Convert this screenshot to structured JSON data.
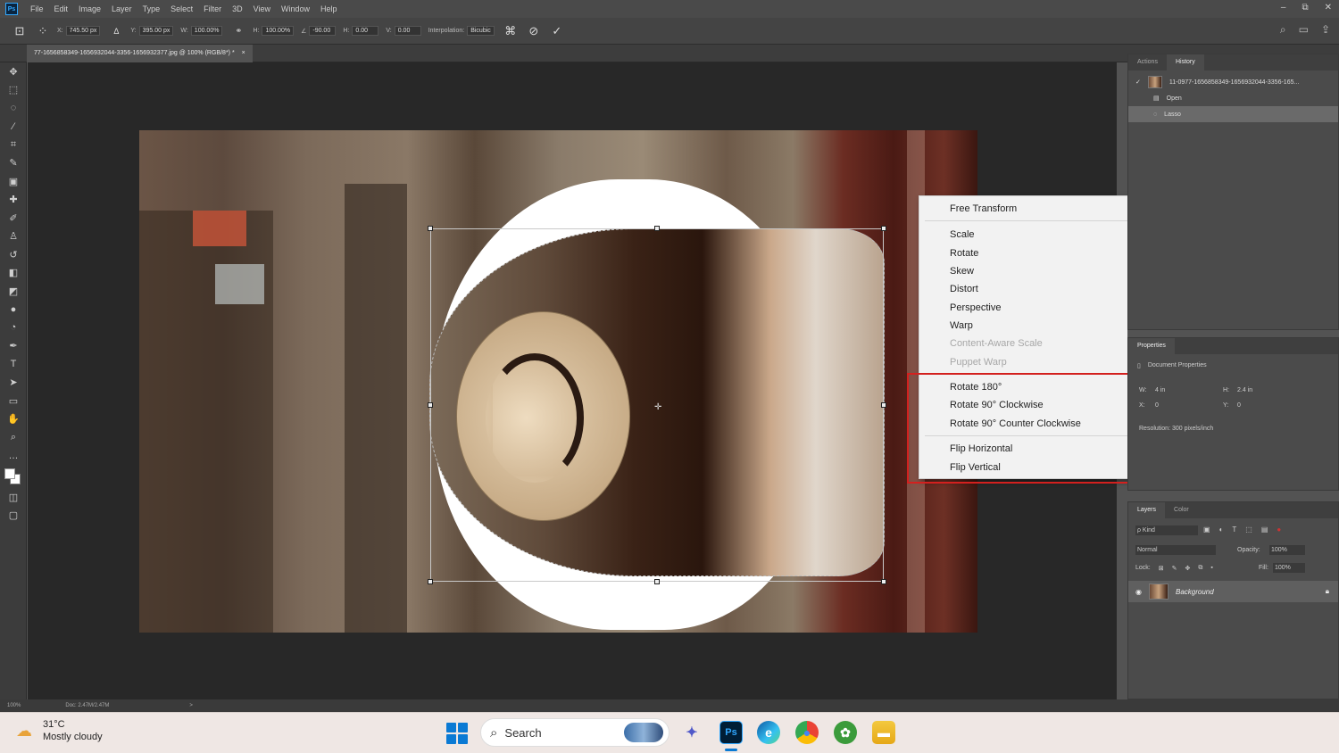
{
  "menubar": {
    "logo": "Ps",
    "items": [
      "File",
      "Edit",
      "Image",
      "Layer",
      "Type",
      "Select",
      "Filter",
      "3D",
      "View",
      "Window",
      "Help"
    ],
    "window_controls": [
      "–",
      "⧉",
      "✕"
    ]
  },
  "options": {
    "x_label": "X:",
    "x_value": "745.50 px",
    "y_label": "Y:",
    "y_value": "395.00 px",
    "w_label": "W:",
    "w_value": "100.00%",
    "h_label": "H:",
    "h_value": "100.00%",
    "angle_value": "-90.00",
    "hskew_label": "H:",
    "hskew_value": "0.00",
    "vskew_label": "V:",
    "vskew_value": "0.00",
    "interp_label": "Interpolation:",
    "interp_value": "Bicubic"
  },
  "document": {
    "tab_title": "77-1656858349-1656932044-3356-1656932377.jpg @ 100% (RGB/8*) *",
    "tab_close": "×"
  },
  "context_menu": {
    "free_transform": "Free Transform",
    "scale": "Scale",
    "rotate": "Rotate",
    "skew": "Skew",
    "distort": "Distort",
    "perspective": "Perspective",
    "warp": "Warp",
    "content_aware_scale": "Content-Aware Scale",
    "puppet_warp": "Puppet Warp",
    "rotate_180": "Rotate 180°",
    "rotate_90_cw": "Rotate 90° Clockwise",
    "rotate_90_ccw": "Rotate 90° Counter Clockwise",
    "flip_horizontal": "Flip Horizontal",
    "flip_vertical": "Flip Vertical"
  },
  "history_panel": {
    "tabs": [
      "Actions",
      "History"
    ],
    "snapshot": "11-0977-1656858349-1656932044-3356-165...",
    "items": [
      "Open",
      "Lasso"
    ]
  },
  "properties_panel": {
    "title": "Properties",
    "section": "Document Properties",
    "w_label": "W:",
    "w_value": "4 in",
    "h_label": "H:",
    "h_value": "2.4 in",
    "x_label": "X:",
    "x_value": "0",
    "y_label": "Y:",
    "y_value": "0",
    "resolution": "Resolution: 300 pixels/inch"
  },
  "layers_panel": {
    "tabs": [
      "Layers",
      "Color"
    ],
    "kind_placeholder": "ρ Kind",
    "blend_mode": "Normal",
    "opacity_label": "Opacity:",
    "opacity_value": "100%",
    "lock_label": "Lock:",
    "fill_label": "Fill:",
    "fill_value": "100%",
    "layer_name": "Background"
  },
  "statusbar": {
    "zoom": "100%",
    "doc": "Doc: 2.47M/2.47M",
    "arrow": ">"
  },
  "taskbar": {
    "temperature": "31°C",
    "condition": "Mostly cloudy",
    "search_placeholder": "Search"
  }
}
